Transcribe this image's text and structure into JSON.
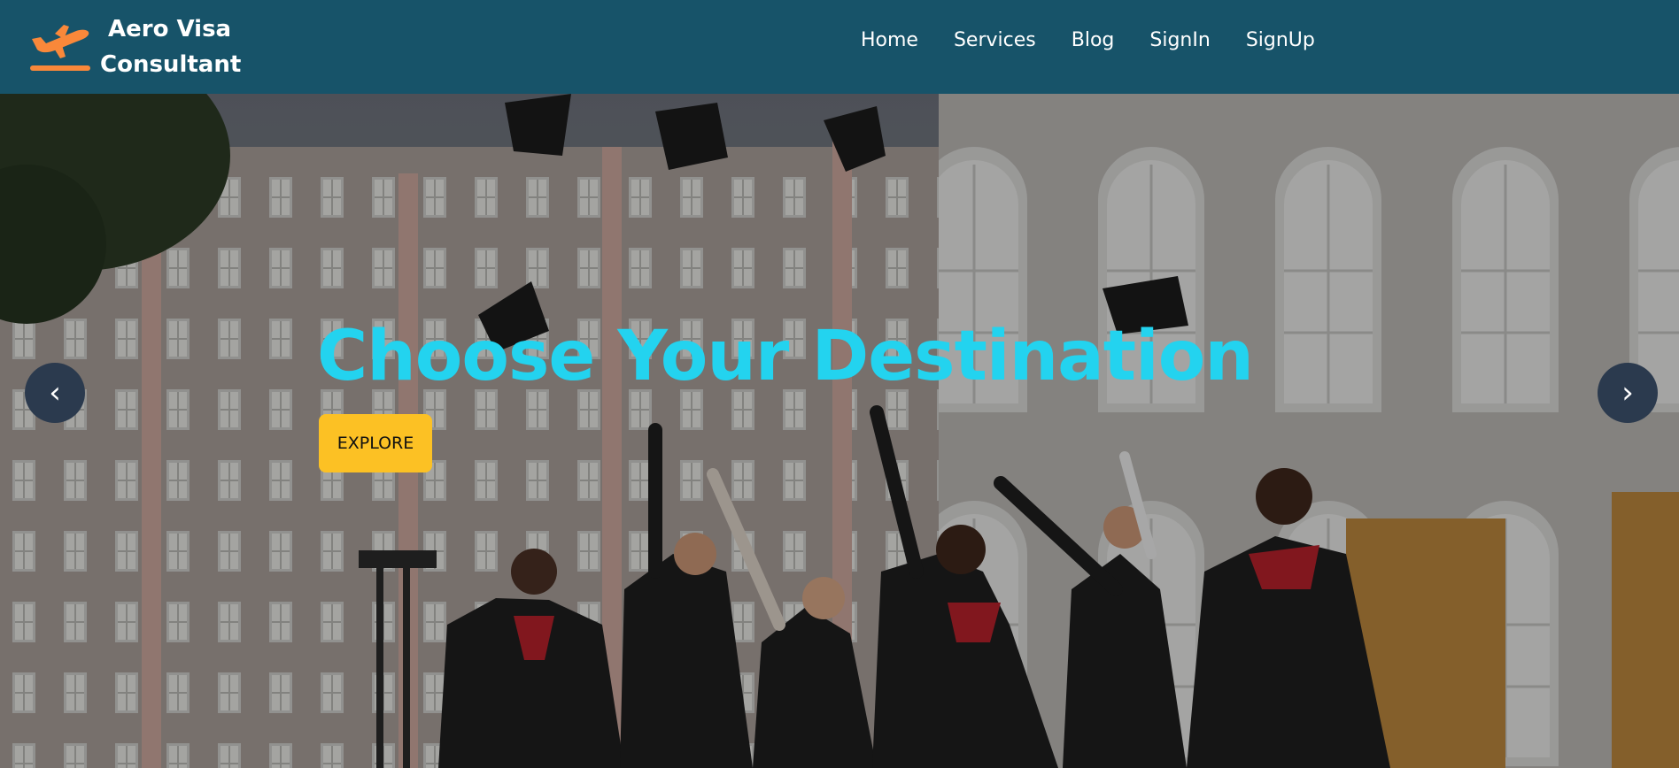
{
  "brand": {
    "name_line1": "Aero Visa",
    "name_line2": "Consultant",
    "icon": "airplane-takeoff-icon",
    "icon_color": "#f9883a"
  },
  "nav": {
    "items": [
      {
        "label": "Home"
      },
      {
        "label": "Services"
      },
      {
        "label": "Blog"
      },
      {
        "label": "SignIn"
      },
      {
        "label": "SignUp"
      }
    ],
    "background": "#175369"
  },
  "hero": {
    "title": "Choose Your Destination",
    "title_color": "#23d3ef",
    "cta_label": "EXPLORE",
    "cta_color": "#fcc124",
    "prev_label": "‹",
    "next_label": "›",
    "background_image": "graduates-throwing-caps-photo"
  }
}
